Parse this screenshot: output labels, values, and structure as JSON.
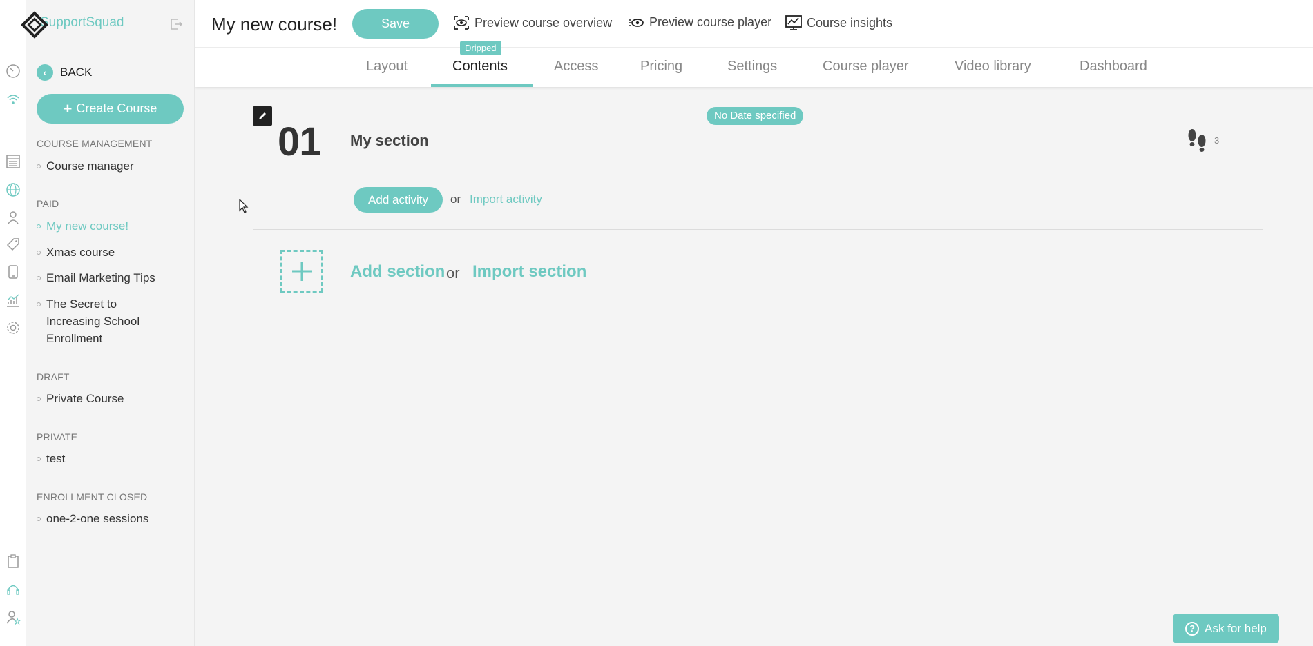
{
  "app": {
    "brand": "SupportSquad"
  },
  "colors": {
    "accent": "#6ec9c1",
    "text": "#333333",
    "background": "#f4f4f4"
  },
  "rail": {
    "icons": [
      "dashboard-icon",
      "wifi-icon",
      "list-icon",
      "globe-icon",
      "user-icon",
      "tag-icon",
      "mobile-icon",
      "chart-icon",
      "gear-icon",
      "clipboard-icon",
      "headset-icon",
      "user-star-icon"
    ]
  },
  "sidebar": {
    "back_label": "BACK",
    "create_label": "Create Course",
    "groups": [
      {
        "title": "COURSE MANAGEMENT",
        "items": [
          "Course manager"
        ]
      },
      {
        "title": "PAID",
        "items": [
          "My new course!",
          "Xmas course",
          "Email Marketing Tips",
          "The Secret to Increasing School Enrollment"
        ]
      },
      {
        "title": "DRAFT",
        "items": [
          "Private Course"
        ]
      },
      {
        "title": "PRIVATE",
        "items": [
          "test"
        ]
      },
      {
        "title": "ENROLLMENT CLOSED",
        "items": [
          "one-2-one sessions"
        ]
      }
    ]
  },
  "header": {
    "course_title": "My new course!",
    "save_label": "Save",
    "links": {
      "preview_overview": "Preview course overview",
      "preview_player": "Preview course player",
      "insights": "Course insights"
    }
  },
  "tabs": {
    "items": [
      "Layout",
      "Contents",
      "Access",
      "Pricing",
      "Settings",
      "Course player",
      "Video library",
      "Dashboard"
    ],
    "active": "Contents",
    "active_badge": "Dripped"
  },
  "section": {
    "number": "01",
    "title": "My section",
    "date_badge": "No Date specified",
    "steps_count": "3",
    "add_activity_label": "Add activity",
    "or_label": "or",
    "import_activity_label": "Import activity"
  },
  "add_section": {
    "add_label": "Add section",
    "or_label": "or",
    "import_label": "Import section"
  },
  "help": {
    "label": "Ask for help"
  }
}
